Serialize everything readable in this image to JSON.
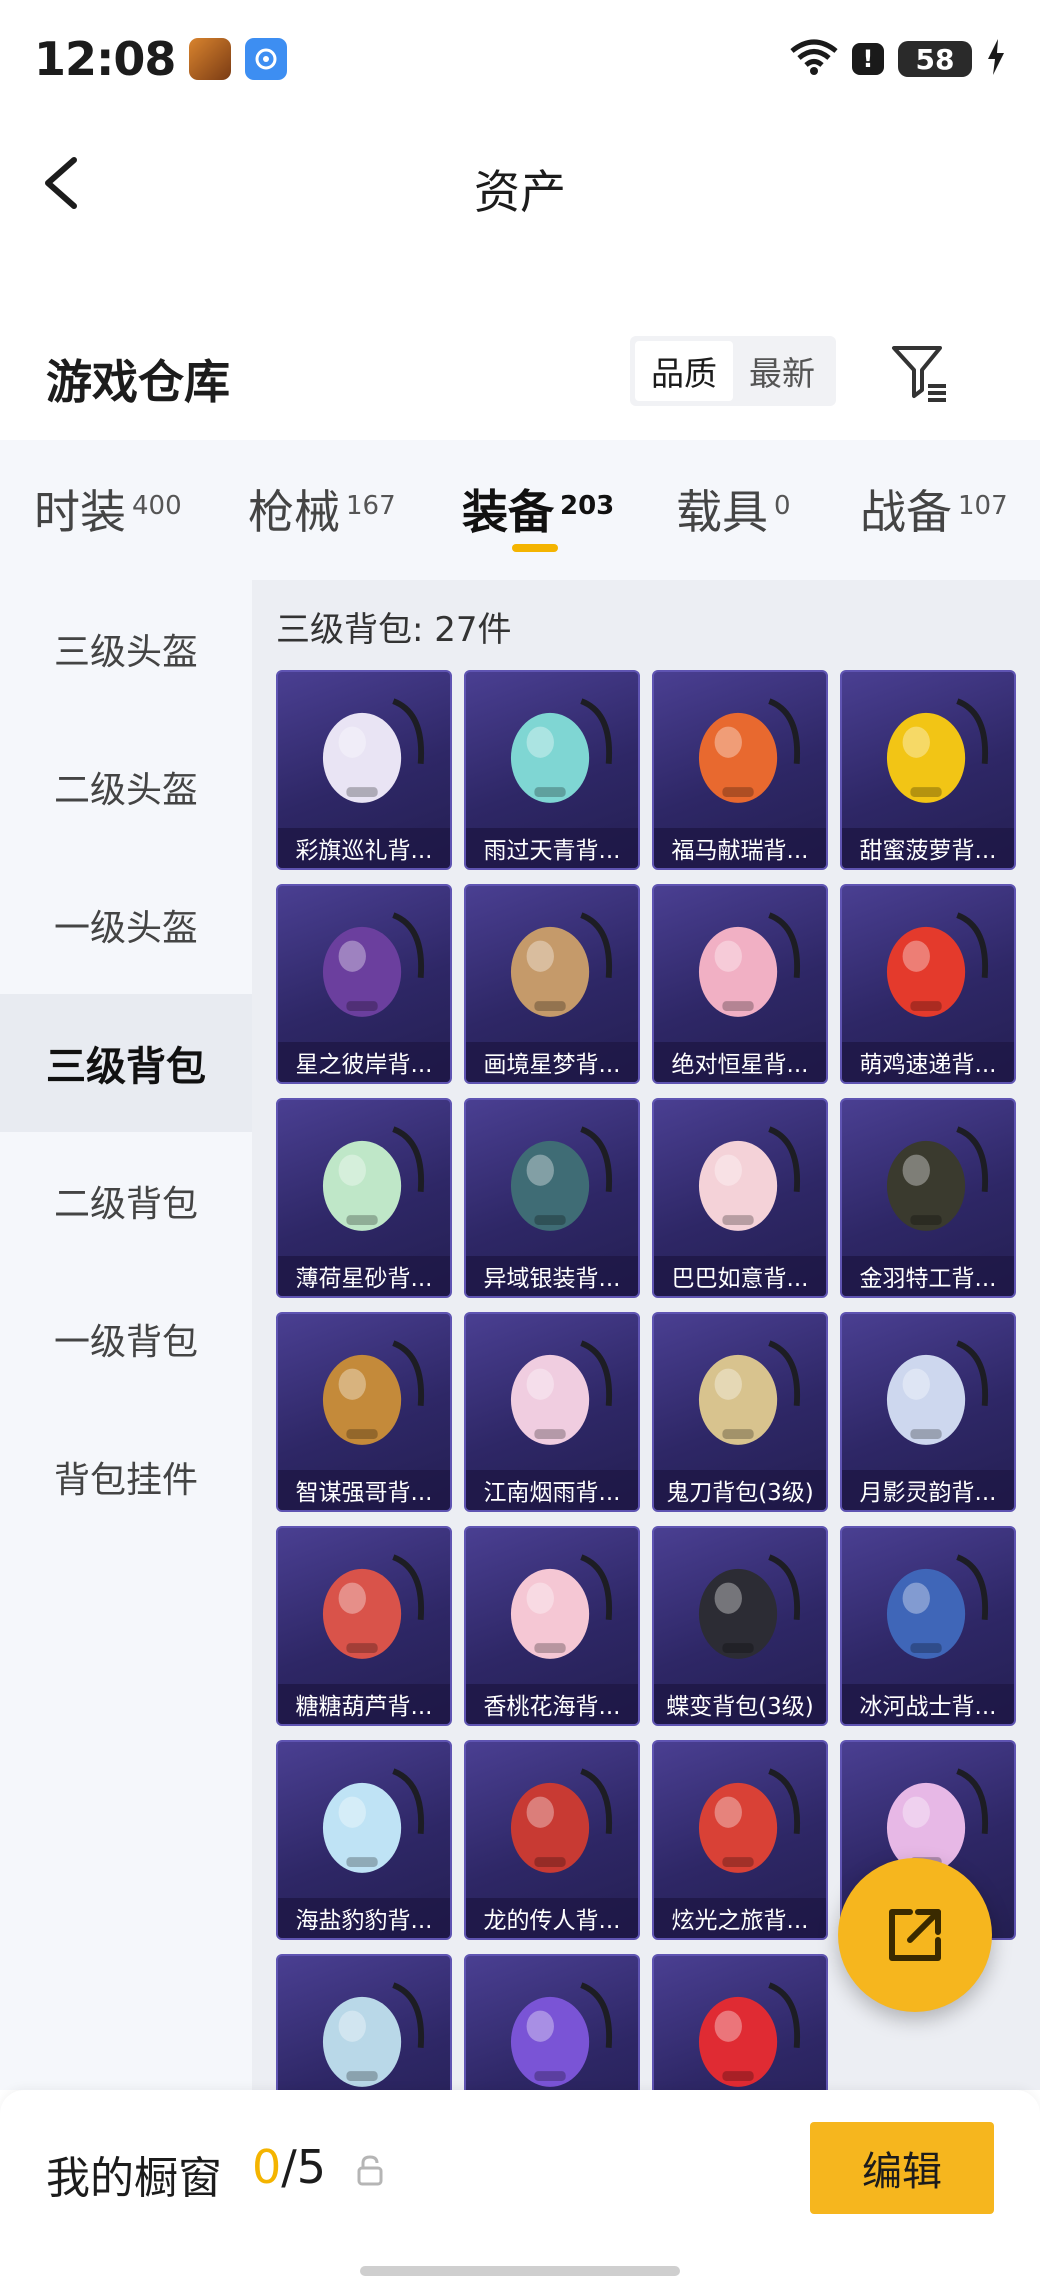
{
  "status_bar": {
    "time": "12:08",
    "battery": "58"
  },
  "header": {
    "title": "资产"
  },
  "section": {
    "title": "游戏仓库",
    "sort_options": [
      "品质",
      "最新"
    ]
  },
  "tabs": [
    {
      "label": "时装",
      "count": "400"
    },
    {
      "label": "枪械",
      "count": "167"
    },
    {
      "label": "装备",
      "count": "203"
    },
    {
      "label": "载具",
      "count": "0"
    },
    {
      "label": "战备",
      "count": "107"
    }
  ],
  "sidebar": {
    "items": [
      "三级头盔",
      "二级头盔",
      "一级头盔",
      "三级背包",
      "二级背包",
      "一级背包",
      "背包挂件"
    ]
  },
  "content": {
    "heading": "三级背包: 27件",
    "items": [
      {
        "name": "彩旗巡礼背...",
        "icon": "backpack-white-lace",
        "color": "#e9e4f4"
      },
      {
        "name": "雨过天青背...",
        "icon": "backpack-teal-flower",
        "color": "#7fd6d3"
      },
      {
        "name": "福马献瑞背...",
        "icon": "backpack-orange-horse",
        "color": "#e8692f"
      },
      {
        "name": "甜蜜菠萝背...",
        "icon": "backpack-pineapple",
        "color": "#f2c515"
      },
      {
        "name": "星之彼岸背...",
        "icon": "backpack-astronaut",
        "color": "#6b3f9e"
      },
      {
        "name": "画境星梦背...",
        "icon": "backpack-mirror-frame",
        "color": "#c59a6a"
      },
      {
        "name": "绝对恒星背...",
        "icon": "backpack-popcorn",
        "color": "#f1b0c4"
      },
      {
        "name": "萌鸡速递背...",
        "icon": "backpack-chicken",
        "color": "#e43a2c"
      },
      {
        "name": "薄荷星砂背...",
        "icon": "backpack-mint-pouch",
        "color": "#bfe7c8"
      },
      {
        "name": "异域银装背...",
        "icon": "backpack-military-teal",
        "color": "#3f6c75"
      },
      {
        "name": "巴巴如意背...",
        "icon": "backpack-pink-cat",
        "color": "#f4d2d8"
      },
      {
        "name": "金羽特工背...",
        "icon": "backpack-black-gold",
        "color": "#3a3a2e"
      },
      {
        "name": "智谋强哥背...",
        "icon": "backpack-bear",
        "color": "#c48a3a"
      },
      {
        "name": "江南烟雨背...",
        "icon": "backpack-lotus",
        "color": "#f0cde0"
      },
      {
        "name": "鬼刀背包(3级)",
        "icon": "backpack-gold-wings",
        "color": "#d8c38e"
      },
      {
        "name": "月影灵韵背...",
        "icon": "backpack-moon",
        "color": "#cdd7ee"
      },
      {
        "name": "糖糖葫芦背...",
        "icon": "backpack-gourd",
        "color": "#d9534a"
      },
      {
        "name": "香桃花海背...",
        "icon": "backpack-peach-dress",
        "color": "#f5c7d4"
      },
      {
        "name": "蝶变背包(3级)",
        "icon": "backpack-butterfly",
        "color": "#2c2c34"
      },
      {
        "name": "冰河战士背...",
        "icon": "backpack-blue-ice",
        "color": "#3f66b8"
      },
      {
        "name": "海盐豹豹背...",
        "icon": "backpack-seal",
        "color": "#bfe3f5"
      },
      {
        "name": "龙的传人背...",
        "icon": "backpack-dragon-red",
        "color": "#c83a33"
      },
      {
        "name": "炫光之旅背...",
        "icon": "backpack-red-monster",
        "color": "#d94136"
      },
      {
        "name": "",
        "icon": "backpack-candy",
        "color": "#e7b8e6"
      },
      {
        "name": "",
        "icon": "backpack-hippo",
        "color": "#b9d8e8"
      },
      {
        "name": "",
        "icon": "backpack-turtle",
        "color": "#7a54d6"
      },
      {
        "name": "",
        "icon": "backpack-ladybug",
        "color": "#e02b33"
      }
    ]
  },
  "bottom_bar": {
    "showcase_label": "我的橱窗",
    "showcase_current": "0",
    "showcase_sep_total": "/5",
    "edit_label": "编辑"
  },
  "colors": {
    "accent": "#f6b61e",
    "card_bg": "#2e2766"
  }
}
